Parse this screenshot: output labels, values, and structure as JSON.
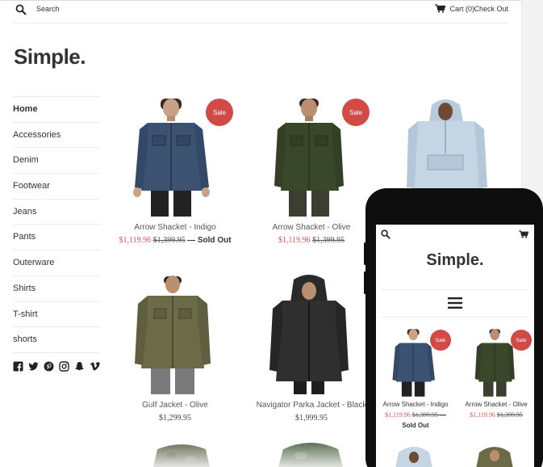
{
  "header": {
    "search_label": "Search",
    "cart_label": "Cart (0)",
    "checkout_label": "Check Out"
  },
  "logo": "Simple.",
  "nav": {
    "items": [
      {
        "label": "Home",
        "active": true
      },
      {
        "label": "Accessories"
      },
      {
        "label": "Denim"
      },
      {
        "label": "Footwear"
      },
      {
        "label": "Jeans"
      },
      {
        "label": "Pants"
      },
      {
        "label": "Outerware"
      },
      {
        "label": "Shirts"
      },
      {
        "label": "T-shirt"
      },
      {
        "label": "shorts"
      }
    ]
  },
  "social": [
    "facebook-icon",
    "twitter-icon",
    "pinterest-icon",
    "instagram-icon",
    "snapchat-icon",
    "vimeo-icon"
  ],
  "products": [
    {
      "name": "Arrow Shacket - Indigo",
      "sale_price": "$1,119.96",
      "compare_price": "$1,399.95",
      "sold_out": "— Sold Out",
      "badge": "Sale"
    },
    {
      "name": "Arrow Shacket - Olive",
      "sale_price": "$1,119.96",
      "compare_price": "$1,399.95",
      "badge": "Sale"
    },
    {
      "name": "",
      "price": ""
    },
    {
      "name": "Gulf Jacket - Olive",
      "price": "$1,299.95"
    },
    {
      "name": "Navigator Parka Jacket - Black",
      "price": "$1,999.95"
    }
  ],
  "mobile": {
    "logo": "Simple.",
    "products": [
      {
        "name": "Arrow Shacket - Indigo",
        "sale_price": "$1,119.96",
        "compare_price": "$1,399.95 —",
        "sold_out": "Sold Out",
        "badge": "Sale"
      },
      {
        "name": "Arrow Shacket - Olive",
        "sale_price": "$1,119.96",
        "compare_price": "$1,399.95",
        "badge": "Sale"
      }
    ]
  },
  "colors": {
    "accent_sale": "#d24a45",
    "text": "#333333",
    "rule": "#ececec"
  }
}
